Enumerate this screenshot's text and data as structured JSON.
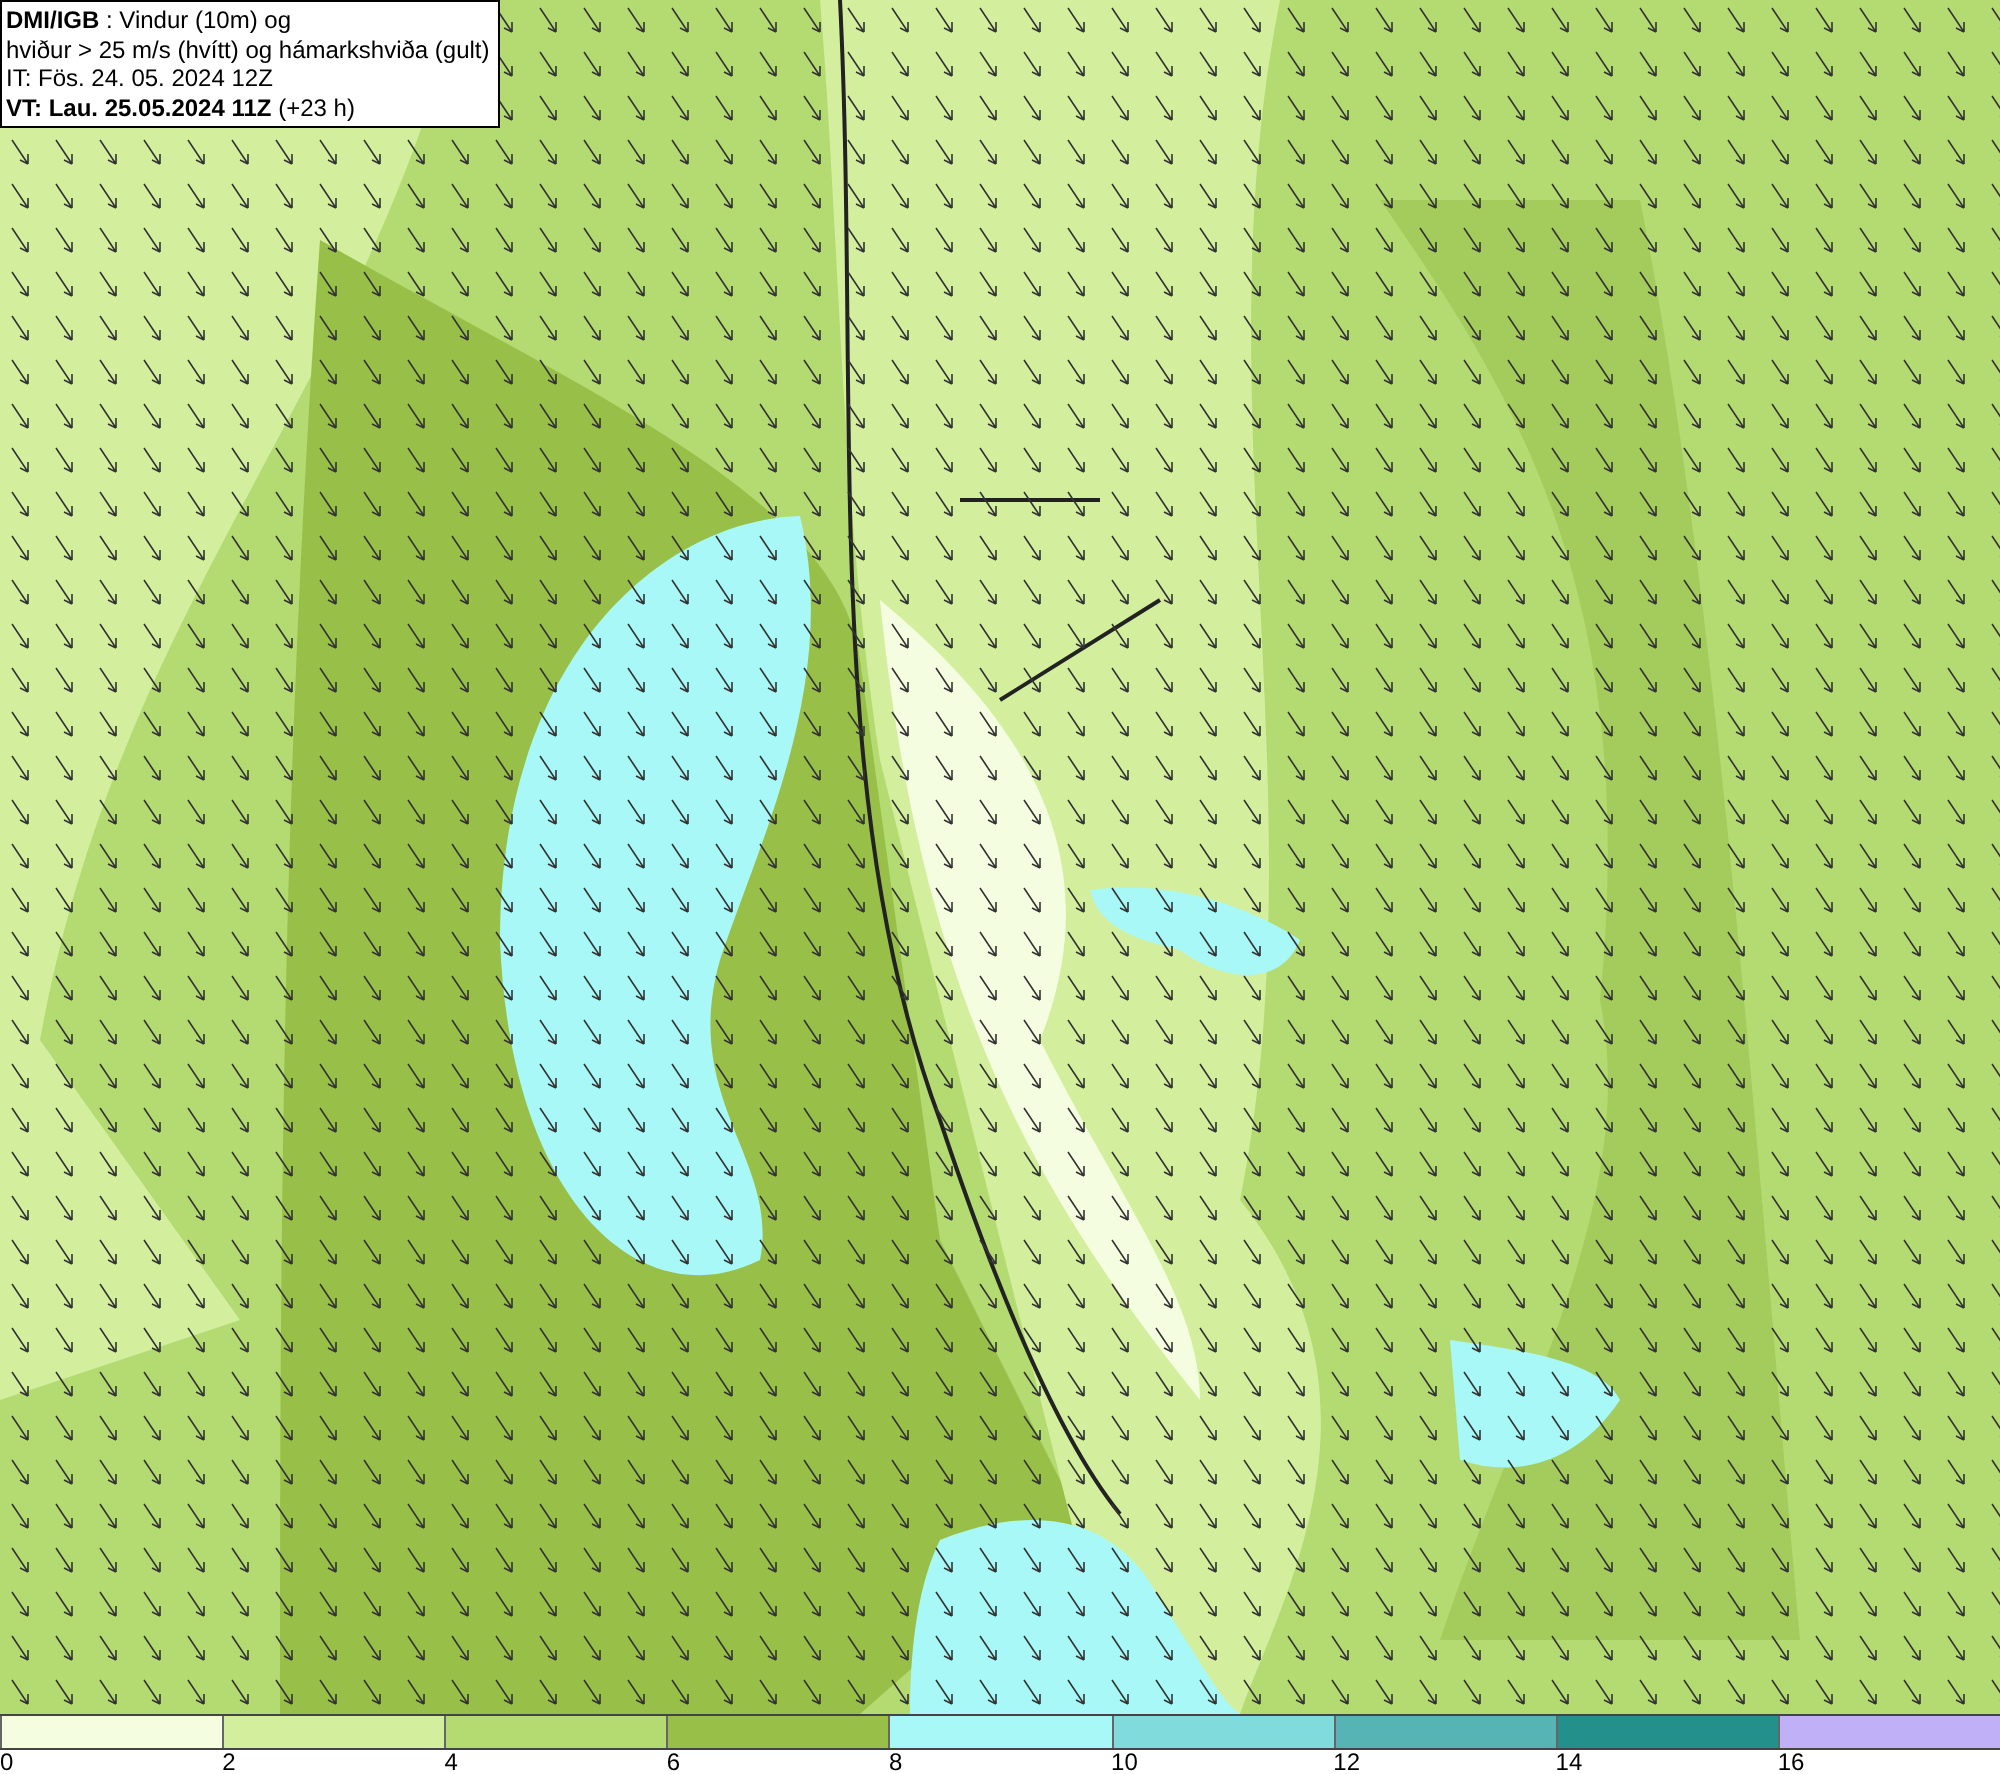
{
  "header": {
    "lines": [
      "**DMI/IGB** : Vindur (10m) og",
      "hviður > 25 m/s (hvítt) og hámarkshviða (gult)",
      "IT: Fös. 24. 05. 2024 12Z",
      "**VT: Lau. 25.05.2024 11Z** (+23 h)"
    ]
  },
  "legend": {
    "bins": [
      {
        "label": "0",
        "color": "#f5fde0"
      },
      {
        "label": "2",
        "color": "#d3ef9e"
      },
      {
        "label": "4",
        "color": "#b4da72"
      },
      {
        "label": "6",
        "color": "#98c048"
      },
      {
        "label": "8",
        "color": "#a8f8f8"
      },
      {
        "label": "10",
        "color": "#80dcdc"
      },
      {
        "label": "12",
        "color": "#56b4b4"
      },
      {
        "label": "14",
        "color": "#24908c"
      },
      {
        "label": "16",
        "color": "#c0b0f8"
      }
    ]
  }
}
